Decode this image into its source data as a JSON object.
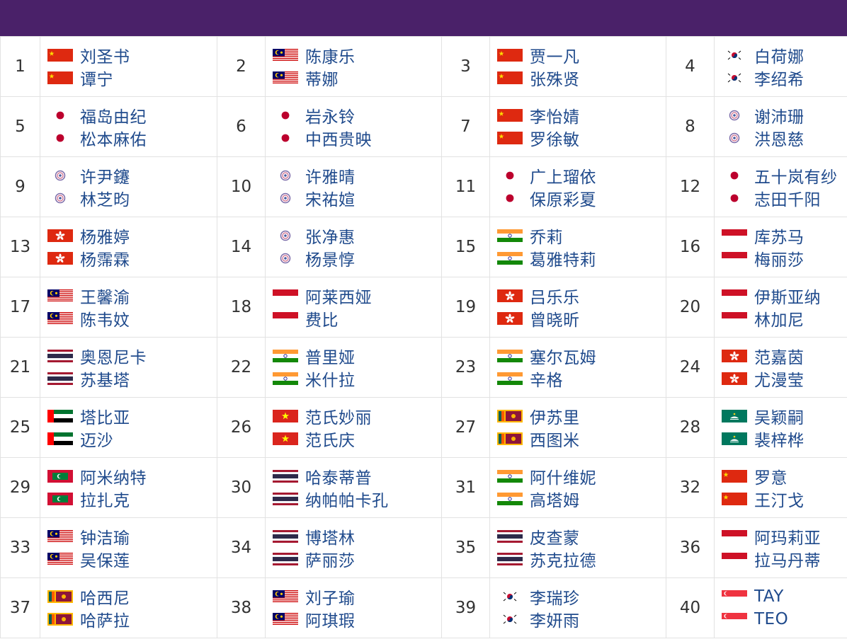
{
  "colors": {
    "header": "#4a2169",
    "name_text": "#1f4a8c",
    "rank_text": "#333333",
    "grid": "#e2e2e2"
  },
  "rankings": [
    {
      "rank": "1",
      "players": [
        {
          "name": "刘圣书",
          "flag": "CHN"
        },
        {
          "name": "谭宁",
          "flag": "CHN"
        }
      ]
    },
    {
      "rank": "2",
      "players": [
        {
          "name": "陈康乐",
          "flag": "MAS"
        },
        {
          "name": "蒂娜",
          "flag": "MAS"
        }
      ]
    },
    {
      "rank": "3",
      "players": [
        {
          "name": "贾一凡",
          "flag": "CHN"
        },
        {
          "name": "张殊贤",
          "flag": "CHN"
        }
      ]
    },
    {
      "rank": "4",
      "players": [
        {
          "name": "白荷娜",
          "flag": "KOR"
        },
        {
          "name": "李绍希",
          "flag": "KOR"
        }
      ]
    },
    {
      "rank": "5",
      "players": [
        {
          "name": "福岛由纪",
          "flag": "JPN"
        },
        {
          "name": "松本麻佑",
          "flag": "JPN"
        }
      ]
    },
    {
      "rank": "6",
      "players": [
        {
          "name": "岩永铃",
          "flag": "JPN"
        },
        {
          "name": "中西贵映",
          "flag": "JPN"
        }
      ]
    },
    {
      "rank": "7",
      "players": [
        {
          "name": "李怡婧",
          "flag": "CHN"
        },
        {
          "name": "罗徐敏",
          "flag": "CHN"
        }
      ]
    },
    {
      "rank": "8",
      "players": [
        {
          "name": "谢沛珊",
          "flag": "TPE"
        },
        {
          "name": "洪恩慈",
          "flag": "TPE"
        }
      ]
    },
    {
      "rank": "9",
      "players": [
        {
          "name": "许尹鑳",
          "flag": "TPE"
        },
        {
          "name": "林芝昀",
          "flag": "TPE"
        }
      ]
    },
    {
      "rank": "10",
      "players": [
        {
          "name": "许雅晴",
          "flag": "TPE"
        },
        {
          "name": "宋祐媗",
          "flag": "TPE"
        }
      ]
    },
    {
      "rank": "11",
      "players": [
        {
          "name": "广上瑠依",
          "flag": "JPN"
        },
        {
          "name": "保原彩夏",
          "flag": "JPN"
        }
      ]
    },
    {
      "rank": "12",
      "players": [
        {
          "name": "五十岚有纱",
          "flag": "JPN"
        },
        {
          "name": "志田千阳",
          "flag": "JPN"
        }
      ]
    },
    {
      "rank": "13",
      "players": [
        {
          "name": "杨雅婷",
          "flag": "HKG"
        },
        {
          "name": "杨霈霖",
          "flag": "HKG"
        }
      ]
    },
    {
      "rank": "14",
      "players": [
        {
          "name": "张净惠",
          "flag": "TPE"
        },
        {
          "name": "杨景惇",
          "flag": "TPE"
        }
      ]
    },
    {
      "rank": "15",
      "players": [
        {
          "name": "乔莉",
          "flag": "IND"
        },
        {
          "name": "葛雅特莉",
          "flag": "IND"
        }
      ]
    },
    {
      "rank": "16",
      "players": [
        {
          "name": "库苏马",
          "flag": "INA"
        },
        {
          "name": "梅丽莎",
          "flag": "INA"
        }
      ]
    },
    {
      "rank": "17",
      "players": [
        {
          "name": "王馨渝",
          "flag": "MAS"
        },
        {
          "name": "陈韦妏",
          "flag": "MAS"
        }
      ]
    },
    {
      "rank": "18",
      "players": [
        {
          "name": "阿莱西娅",
          "flag": "INA"
        },
        {
          "name": "费比",
          "flag": "INA"
        }
      ]
    },
    {
      "rank": "19",
      "players": [
        {
          "name": "吕乐乐",
          "flag": "HKG"
        },
        {
          "name": "曾晓昕",
          "flag": "HKG"
        }
      ]
    },
    {
      "rank": "20",
      "players": [
        {
          "name": "伊斯亚纳",
          "flag": "INA"
        },
        {
          "name": "林加尼",
          "flag": "INA"
        }
      ]
    },
    {
      "rank": "21",
      "players": [
        {
          "name": "奥恩尼卡",
          "flag": "THA"
        },
        {
          "name": "苏基塔",
          "flag": "THA"
        }
      ]
    },
    {
      "rank": "22",
      "players": [
        {
          "name": "普里娅",
          "flag": "IND"
        },
        {
          "name": "米什拉",
          "flag": "IND"
        }
      ]
    },
    {
      "rank": "23",
      "players": [
        {
          "name": "塞尔瓦姆",
          "flag": "IND"
        },
        {
          "name": "辛格",
          "flag": "IND"
        }
      ]
    },
    {
      "rank": "24",
      "players": [
        {
          "name": "范嘉茵",
          "flag": "HKG"
        },
        {
          "name": "尤漫莹",
          "flag": "HKG"
        }
      ]
    },
    {
      "rank": "25",
      "players": [
        {
          "name": "塔比亚",
          "flag": "UAE"
        },
        {
          "name": "迈沙",
          "flag": "UAE"
        }
      ]
    },
    {
      "rank": "26",
      "players": [
        {
          "name": "范氏妙丽",
          "flag": "VIE"
        },
        {
          "name": "范氏庆",
          "flag": "VIE"
        }
      ]
    },
    {
      "rank": "27",
      "players": [
        {
          "name": "伊苏里",
          "flag": "SRI"
        },
        {
          "name": "西图米",
          "flag": "SRI"
        }
      ]
    },
    {
      "rank": "28",
      "players": [
        {
          "name": "吴颖嗣",
          "flag": "MAC"
        },
        {
          "name": "裴梓桦",
          "flag": "MAC"
        }
      ]
    },
    {
      "rank": "29",
      "players": [
        {
          "name": "阿米纳特",
          "flag": "MDV"
        },
        {
          "name": "拉扎克",
          "flag": "MDV"
        }
      ]
    },
    {
      "rank": "30",
      "players": [
        {
          "name": "哈泰蒂普",
          "flag": "THA"
        },
        {
          "name": "纳帕帕卡孔",
          "flag": "THA"
        }
      ]
    },
    {
      "rank": "31",
      "players": [
        {
          "name": "阿什维妮",
          "flag": "IND"
        },
        {
          "name": "高塔姆",
          "flag": "IND"
        }
      ]
    },
    {
      "rank": "32",
      "players": [
        {
          "name": "罗意",
          "flag": "CHN"
        },
        {
          "name": "王汀戈",
          "flag": "CHN"
        }
      ]
    },
    {
      "rank": "33",
      "players": [
        {
          "name": "钟洁瑜",
          "flag": "MAS"
        },
        {
          "name": "吴保莲",
          "flag": "MAS"
        }
      ]
    },
    {
      "rank": "34",
      "players": [
        {
          "name": "博塔林",
          "flag": "THA"
        },
        {
          "name": "萨丽莎",
          "flag": "THA"
        }
      ]
    },
    {
      "rank": "35",
      "players": [
        {
          "name": "皮查蒙",
          "flag": "THA"
        },
        {
          "name": "苏克拉德",
          "flag": "THA"
        }
      ]
    },
    {
      "rank": "36",
      "players": [
        {
          "name": "阿玛莉亚",
          "flag": "INA"
        },
        {
          "name": "拉马丹蒂",
          "flag": "INA"
        }
      ]
    },
    {
      "rank": "37",
      "players": [
        {
          "name": "哈西尼",
          "flag": "SRI"
        },
        {
          "name": "哈萨拉",
          "flag": "SRI"
        }
      ]
    },
    {
      "rank": "38",
      "players": [
        {
          "name": "刘子瑜",
          "flag": "MAS"
        },
        {
          "name": "阿琪瑕",
          "flag": "MAS"
        }
      ]
    },
    {
      "rank": "39",
      "players": [
        {
          "name": "李瑞珍",
          "flag": "KOR"
        },
        {
          "name": "李妍雨",
          "flag": "KOR"
        }
      ]
    },
    {
      "rank": "40",
      "players": [
        {
          "name": "TAY",
          "flag": "SGP"
        },
        {
          "name": "TEO",
          "flag": "SGP"
        }
      ]
    }
  ]
}
